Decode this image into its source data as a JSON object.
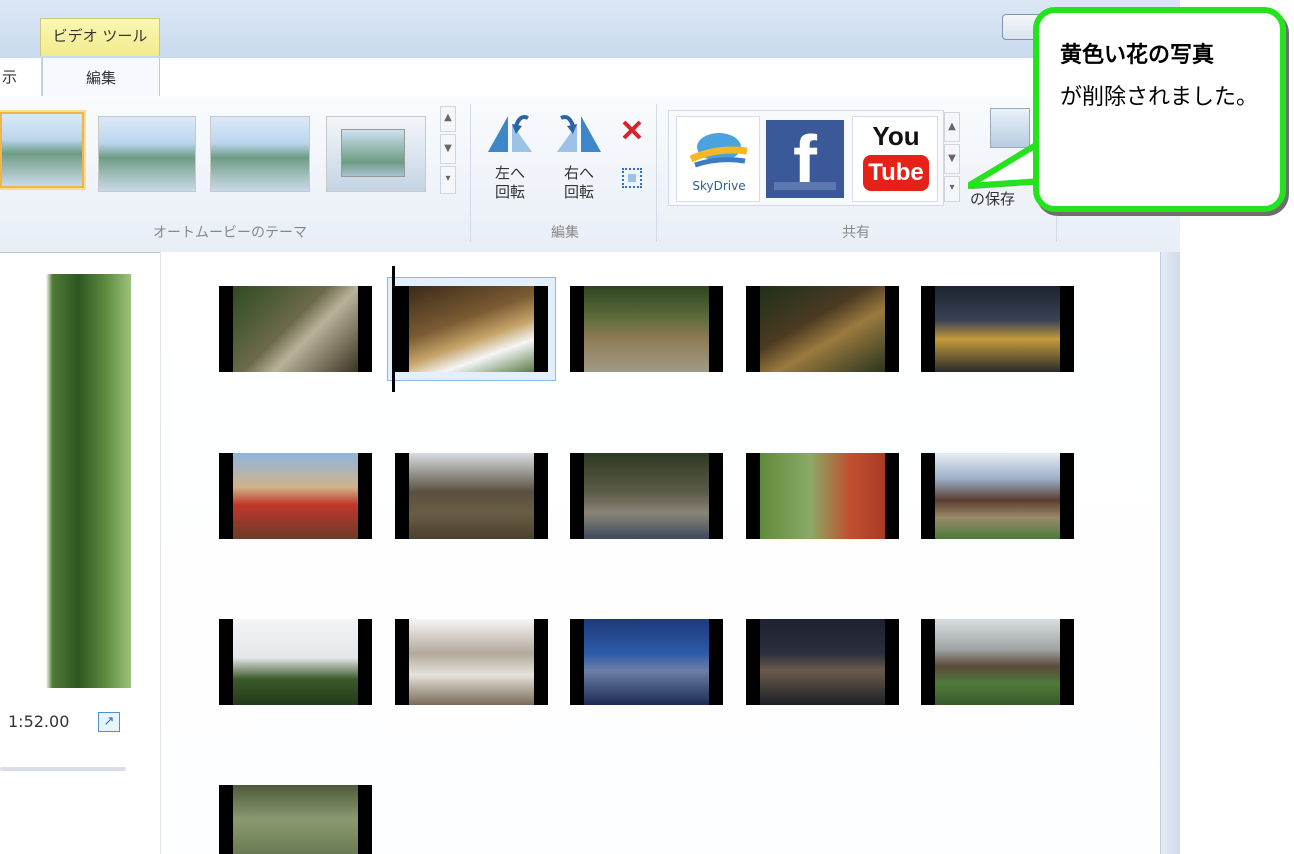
{
  "window": {
    "contextual_tab": "ビデオ ツール",
    "tabs": [
      {
        "label": "示"
      },
      {
        "label": "編集"
      }
    ]
  },
  "ribbon": {
    "themes_group": {
      "label": "オートムービーのテーマ"
    },
    "edit_group": {
      "label": "編集",
      "rotate_left": {
        "line1": "左へ",
        "line2": "回転"
      },
      "rotate_right": {
        "line1": "右へ",
        "line2": "回転"
      },
      "remove_icon": "remove-x-icon",
      "select_all_icon": "select-all-icon"
    },
    "share_group": {
      "label": "共有",
      "skydrive": "SkyDrive",
      "facebook": "f",
      "youtube_top": "You",
      "youtube_bottom": "Tube"
    },
    "save_movie": {
      "label": "の保存"
    }
  },
  "preview": {
    "time": "1:52.00"
  },
  "callout": {
    "bold": "黄色い花の写真",
    "text": "が削除されました。"
  },
  "colors": {
    "callout_border": "#22e31c",
    "selection": "#8ab6e8",
    "theme_selected": "#f2b347",
    "youtube_red": "#e62117",
    "facebook_blue": "#3b5998"
  }
}
